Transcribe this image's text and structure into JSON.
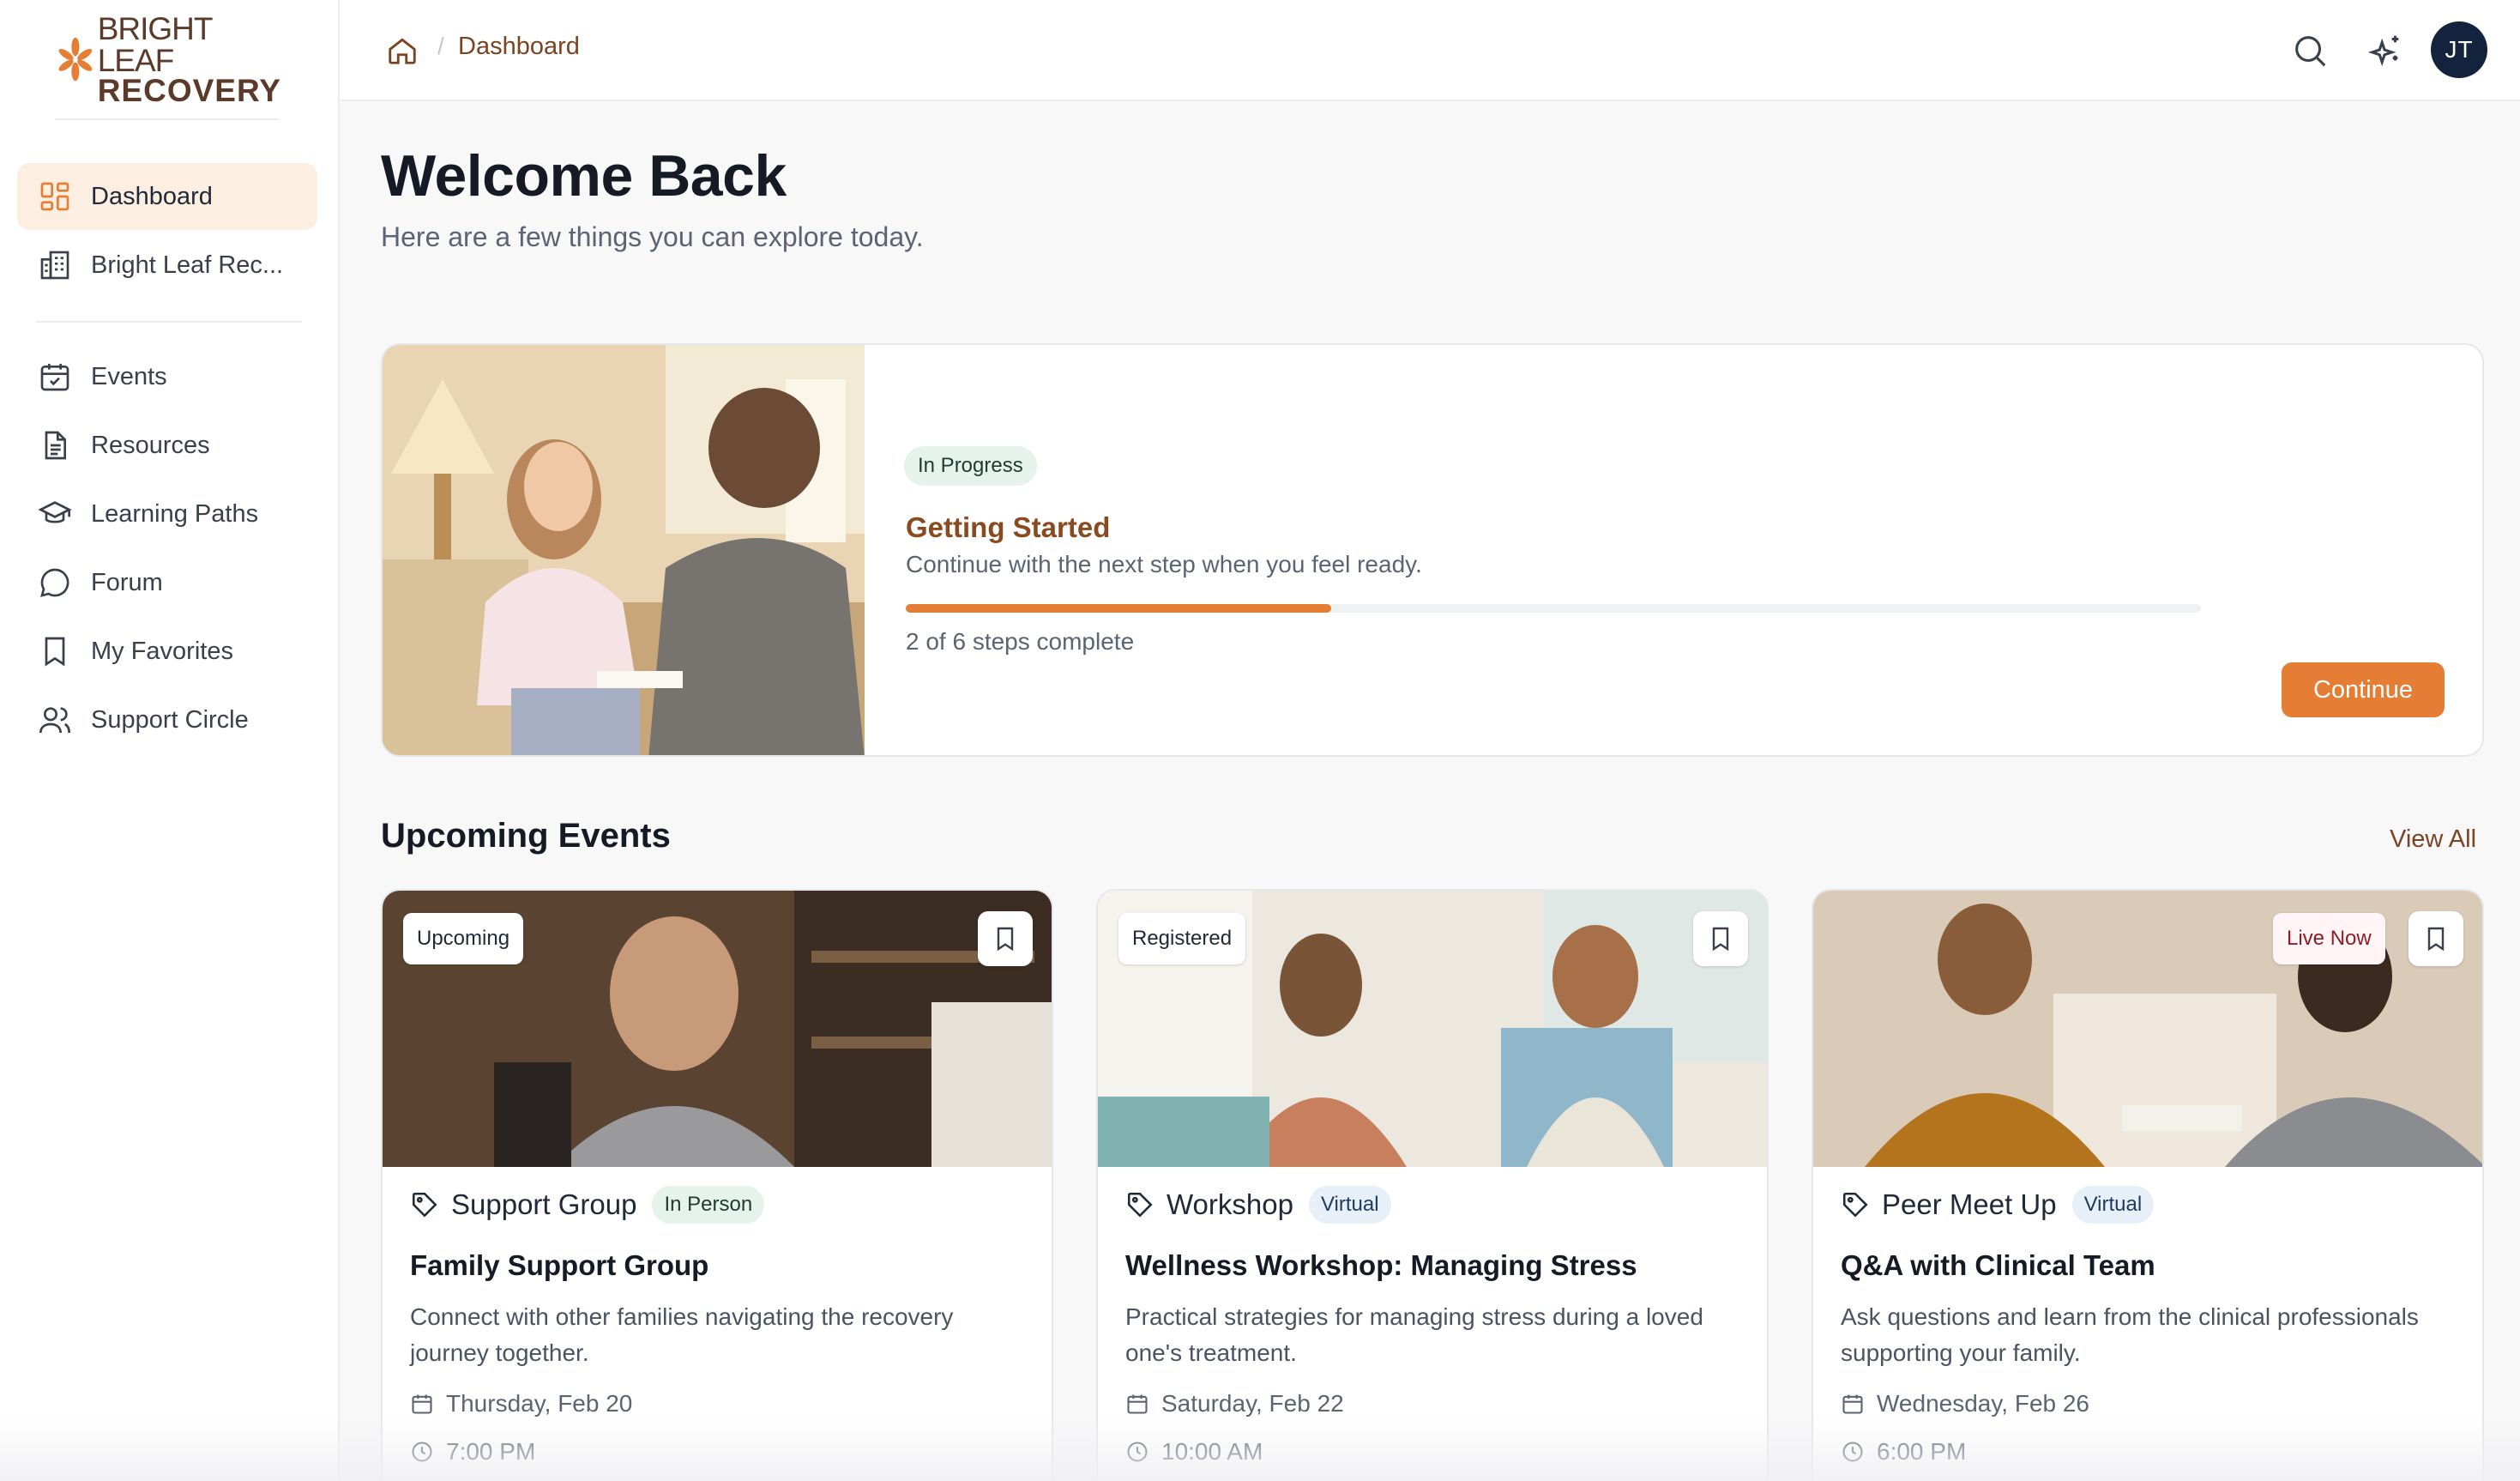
{
  "brand": {
    "line1": "BRIGHT LEAF",
    "line2": "RECOVERY",
    "accent": "#e57d35"
  },
  "sidebar": {
    "items": [
      {
        "label": "Dashboard",
        "icon": "grid-icon",
        "active": true
      },
      {
        "label": "Bright Leaf Rec...",
        "icon": "building-icon"
      },
      {
        "label": "Events",
        "icon": "calendar-check-icon"
      },
      {
        "label": "Resources",
        "icon": "document-icon"
      },
      {
        "label": "Learning Paths",
        "icon": "graduation-cap-icon"
      },
      {
        "label": "Forum",
        "icon": "chat-bubble-icon"
      },
      {
        "label": "My Favorites",
        "icon": "bookmark-icon"
      },
      {
        "label": "Support Circle",
        "icon": "users-icon"
      }
    ]
  },
  "header": {
    "breadcrumb_sep": "/",
    "breadcrumb_current": "Dashboard",
    "avatar_initials": "JT"
  },
  "main": {
    "title": "Welcome Back",
    "subtitle": "Here are a few things you can explore today."
  },
  "progress_card": {
    "badge": "In Progress",
    "title": "Getting Started",
    "description": "Continue with the next step when you feel ready.",
    "completed": 2,
    "total": 6,
    "steps_text": "2 of 6 steps complete",
    "button": "Continue"
  },
  "events": {
    "section_title": "Upcoming Events",
    "view_all": "View All",
    "items": [
      {
        "status": "Upcoming",
        "type": "Support Group",
        "mode": "In Person",
        "title": "Family Support Group",
        "description": "Connect with other families navigating the recovery journey together.",
        "date": "Thursday, Feb 20",
        "time": "7:00 PM"
      },
      {
        "status": "Registered",
        "type": "Workshop",
        "mode": "Virtual",
        "title": "Wellness Workshop: Managing Stress",
        "description": "Practical strategies for managing stress during a loved one's treatment.",
        "date": "Saturday, Feb 22",
        "time": "10:00 AM"
      },
      {
        "status": "Live Now",
        "type": "Peer Meet Up",
        "mode": "Virtual",
        "title": "Q&A with Clinical Team",
        "description": "Ask questions and learn from the clinical professionals supporting your family.",
        "date": "Wednesday, Feb 26",
        "time": "6:00 PM"
      }
    ]
  }
}
